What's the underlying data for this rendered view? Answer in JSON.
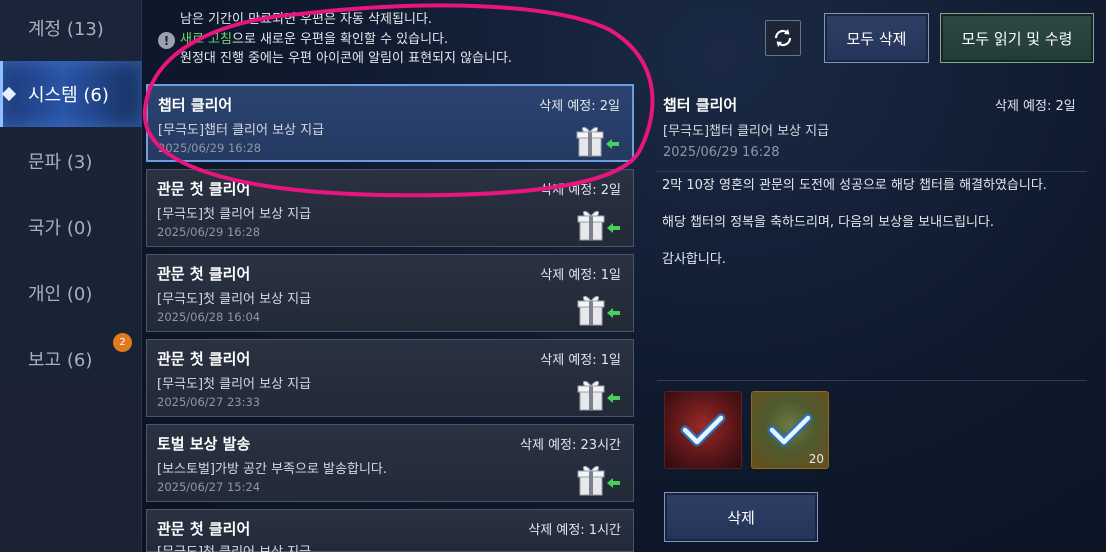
{
  "sidebar": {
    "items": [
      {
        "label": "계정 (13)"
      },
      {
        "label": "시스템 (6)"
      },
      {
        "label": "문파 (3)"
      },
      {
        "label": "국가 (0)"
      },
      {
        "label": "개인 (0)"
      },
      {
        "label": "보고 (6)"
      }
    ],
    "report_badge": "2"
  },
  "notice": {
    "line1": "남은 기간이 만료되면 우편은 자동 삭제됩니다.",
    "line2_highlight": "새로 고침",
    "line2_rest": "으로 새로운 우편을 확인할 수 있습니다.",
    "line3": "원정대 진행 중에는 우편 아이콘에 알림이 표현되지 않습니다."
  },
  "toolbar": {
    "refresh_icon": "refresh-icon",
    "delete_all_label": "모두 삭제",
    "read_all_label": "모두 읽기 및 수령"
  },
  "mails": [
    {
      "title": "챕터 클리어",
      "expire": "삭제 예정: 2일",
      "subtitle": "[무극도]챕터 클리어 보상 지급",
      "date": "2025/06/29 16:28"
    },
    {
      "title": "관문 첫 클리어",
      "expire": "삭제 예정: 2일",
      "subtitle": "[무극도]첫 클리어 보상 지급",
      "date": "2025/06/29 16:28"
    },
    {
      "title": "관문 첫 클리어",
      "expire": "삭제 예정: 1일",
      "subtitle": "[무극도]첫 클리어 보상 지급",
      "date": "2025/06/28 16:04"
    },
    {
      "title": "관문 첫 클리어",
      "expire": "삭제 예정: 1일",
      "subtitle": "[무극도]첫 클리어 보상 지급",
      "date": "2025/06/27 23:33"
    },
    {
      "title": "토벌 보상 발송",
      "expire": "삭제 예정: 23시간",
      "subtitle": "[보스토벌]가방 공간 부족으로 발송합니다.",
      "date": "2025/06/27 15:24"
    },
    {
      "title": "관문 첫 클리어",
      "expire": "삭제 예정: 1시간",
      "subtitle": "[무극도]첫 클리어 보상 지급",
      "date": ""
    }
  ],
  "detail": {
    "title": "챕터 클리어",
    "expire": "삭제 예정: 2일",
    "subtitle": "[무극도]챕터 클리어 보상 지급",
    "date": "2025/06/29 16:28",
    "body": [
      "2막 10장 영혼의 관문의 도전에 성공으로 해당 챕터를 해결하였습니다.",
      "해당 챕터의 정복을 축하드리며, 다음의 보상을 보내드립니다.",
      "감사합니다."
    ],
    "rewards": [
      {
        "icon": "red-item-icon",
        "count": ""
      },
      {
        "icon": "green-item-icon",
        "count": "20"
      }
    ],
    "delete_label": "삭제"
  },
  "colors": {
    "highlight_green": "#6fd46c",
    "annotation_pink": "#e8157f",
    "badge_orange": "#e07a1d"
  }
}
